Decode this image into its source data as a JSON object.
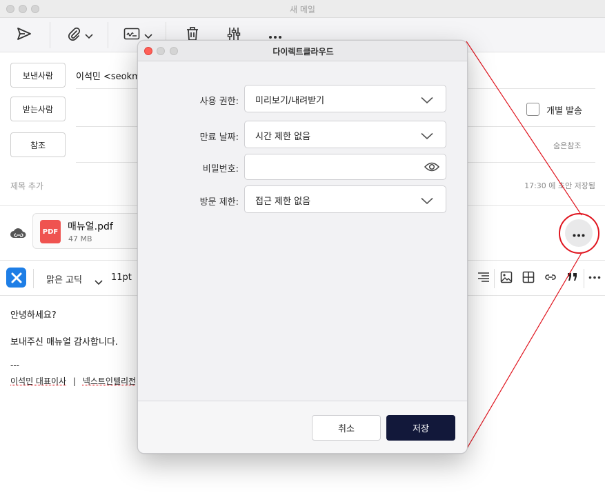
{
  "window": {
    "title": "새 메일"
  },
  "toolbar": {
    "icons": [
      "send-icon",
      "paperclip-icon",
      "signature-icon",
      "trash-icon",
      "sliders-icon",
      "more-icon"
    ]
  },
  "header": {
    "from_button": "보낸사람",
    "from_value": "이석민 <seokm",
    "to_button": "받는사람",
    "cc_button": "참조",
    "individual_send_label": "개별 발송",
    "bcc_link": "숨은참조",
    "subject_placeholder": "제목 추가",
    "saved_status": "17:30 에 초안 저장됨"
  },
  "attachment": {
    "type_badge": "PDF",
    "name": "매뉴얼.pdf",
    "size": "47 MB"
  },
  "editor_toolbar": {
    "font_name": "맑은 고딕",
    "font_size": "11pt"
  },
  "body": {
    "line1": "안녕하세요?",
    "line2": "보내주신 매뉴얼 감사합니다.",
    "separator": "---",
    "sig_name": "이석민 대표이사",
    "sig_divider": "|",
    "sig_company": "넥스트인텔리전"
  },
  "dialog": {
    "title": "다이렉트클라우드",
    "permission_label": "사용 권한:",
    "permission_value": "미리보기/내려받기",
    "expiry_label": "만료 날짜:",
    "expiry_value": "시간 제한 없음",
    "password_label": "비밀번호:",
    "password_value": "",
    "visit_label": "방문 제한:",
    "visit_value": "접근 제한 없음",
    "cancel": "취소",
    "save": "저장"
  },
  "colors": {
    "accent_red": "#e0141e",
    "save_button": "#12183a",
    "pdf_badge": "#ef5350",
    "logo_blue": "#1e7ee6"
  }
}
